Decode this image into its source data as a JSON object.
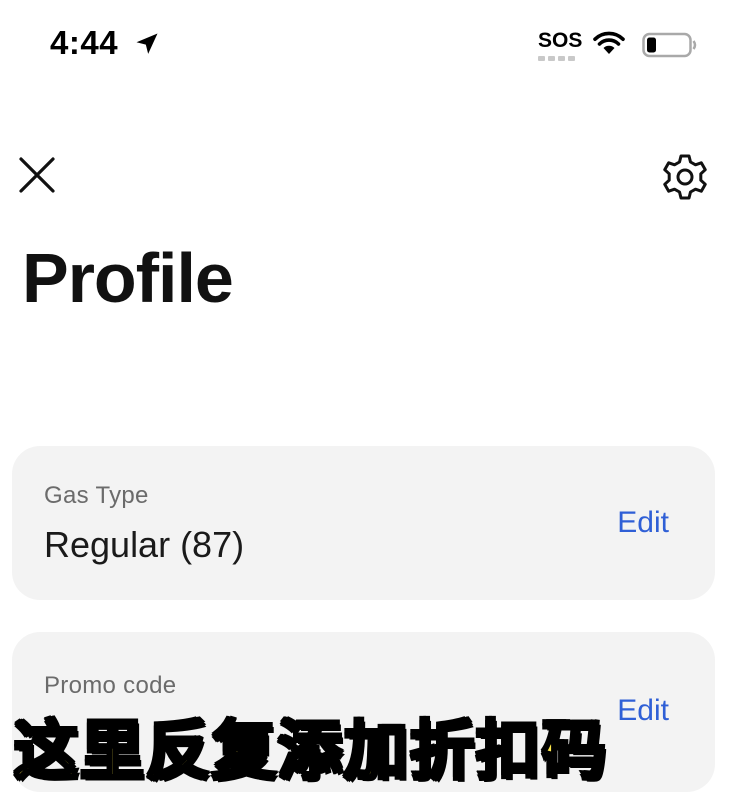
{
  "status_bar": {
    "time": "4:44",
    "sos": "SOS"
  },
  "header": {
    "title": "Profile"
  },
  "cards": {
    "gas_type": {
      "label": "Gas Type",
      "value": "Regular (87)",
      "edit_label": "Edit"
    },
    "promo_code": {
      "label": "Promo code",
      "edit_label": "Edit"
    }
  },
  "overlay": {
    "caption": "这里反复添加折扣码"
  },
  "colors": {
    "accent": "#2f5fd6",
    "card_bg": "#f3f3f3",
    "caption_fill": "#ffe94a"
  },
  "icons": [
    "location-arrow-icon",
    "wifi-icon",
    "battery-icon",
    "close-icon",
    "gear-icon"
  ]
}
